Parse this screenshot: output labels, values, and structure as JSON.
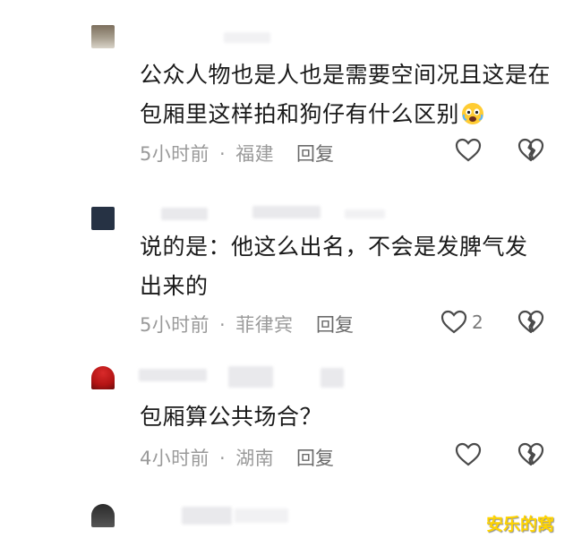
{
  "comments": [
    {
      "text": "公众人物也是人也是需要空间况且这是在包厢里这样拍和狗仔有什么区别",
      "emoji": "scared-face-emoji",
      "time": "5小时前",
      "location": "福建",
      "reply_label": "回复",
      "likes": ""
    },
    {
      "text": "说的是：他这么出名，不会是发脾气发出来的",
      "time": "5小时前",
      "location": "菲律宾",
      "reply_label": "回复",
      "likes": "2"
    },
    {
      "text": "包厢算公共场合？",
      "time": "4小时前",
      "location": "湖南",
      "reply_label": "回复",
      "likes": ""
    }
  ],
  "separator": "·",
  "watermark": "安乐的窝",
  "colors": {
    "text": "#1a1a1a",
    "meta": "#9a9a9a",
    "watermark": "#ffd400"
  }
}
